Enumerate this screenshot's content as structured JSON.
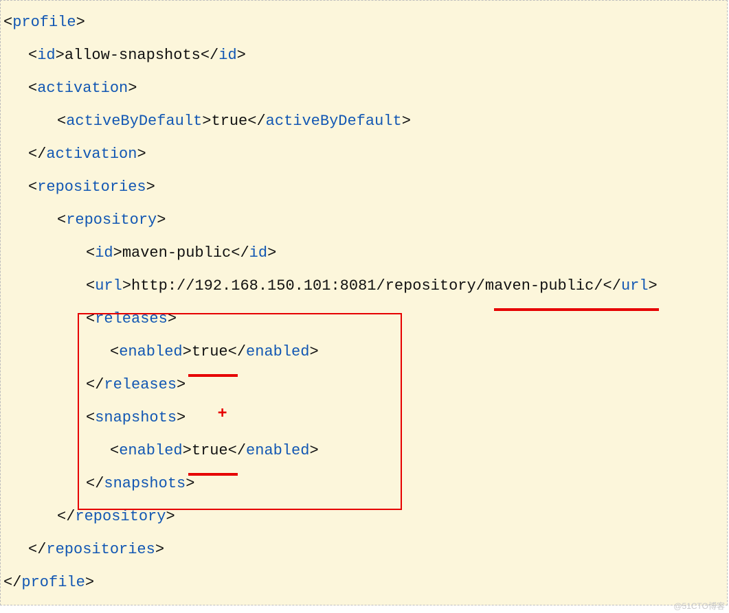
{
  "xml": {
    "profile_open": "profile",
    "profile_close": "profile",
    "id_open": "id",
    "id_value": "allow-snapshots",
    "id_close": "id",
    "activation_open": "activation",
    "activeByDefault_open": "activeByDefault",
    "activeByDefault_value": "true",
    "activeByDefault_close": "activeByDefault",
    "activation_close": "activation",
    "repositories_open": "repositories",
    "repository_open": "repository",
    "repo_id_open": "id",
    "repo_id_value": "maven-public",
    "repo_id_close": "id",
    "url_open": "url",
    "url_value": "http://192.168.150.101:8081/repository/maven-public/",
    "url_close": "url",
    "releases_open": "releases",
    "enabled1_open": "enabled",
    "enabled1_value": "true",
    "enabled1_close": "enabled",
    "releases_close": "releases",
    "snapshots_open": "snapshots",
    "enabled2_open": "enabled",
    "enabled2_value": "true",
    "enabled2_close": "enabled",
    "snapshots_close": "snapshots",
    "repository_close": "repository",
    "repositories_close": "repositories"
  },
  "annotations": {
    "plus": "+"
  },
  "watermark": "@51CTO博客"
}
